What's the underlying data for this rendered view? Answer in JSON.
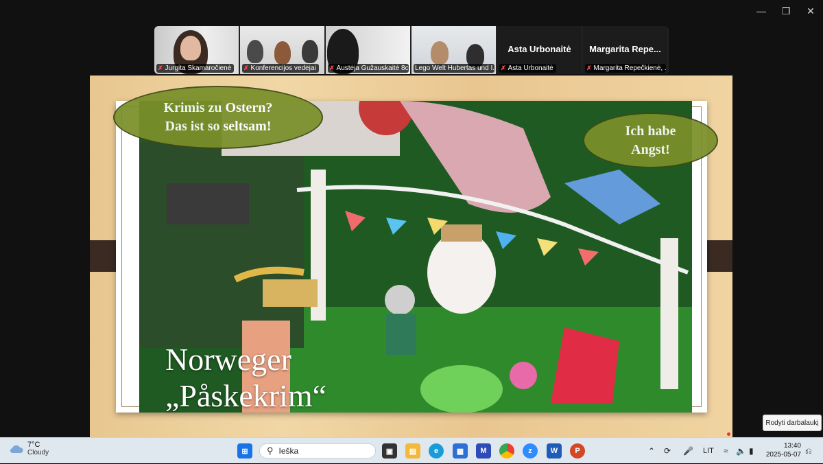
{
  "meeting": {
    "participants": [
      {
        "name": "Jurgita Skamaročienė",
        "muted": true
      },
      {
        "name": "Konferencijos vedėjai",
        "muted": true
      },
      {
        "name": "Austėja Gužauskaitė 8c",
        "muted": true
      },
      {
        "name": "Lego Welt Hubertas und I...",
        "muted": false,
        "active": true
      },
      {
        "name": "Asta Urbonaitė",
        "big_name": "Asta Urbonaitė",
        "muted": true
      },
      {
        "name": "Margarita Repečkienė, ...",
        "big_name": "Margarita Repe...",
        "muted": true
      }
    ]
  },
  "slide": {
    "bubble_left": [
      "Krimis zu Ostern?",
      "Das ist so seltsam!"
    ],
    "bubble_right": [
      "Ich habe",
      "Angst!"
    ],
    "title_line1": "Norweger",
    "title_line2": "„Påskekrim“"
  },
  "tooltip": "Rodyti darbalaukį",
  "taskbar": {
    "weather_temp": "7°C",
    "weather_desc": "Cloudy",
    "search_placeholder": "Ieška",
    "language": "LIT",
    "time": "13:40",
    "date": "2025-05-07"
  },
  "colors": {
    "active_border": "#3fd37a",
    "bubble": "#7a8f2a",
    "slide_bg": "#e8c78f"
  }
}
